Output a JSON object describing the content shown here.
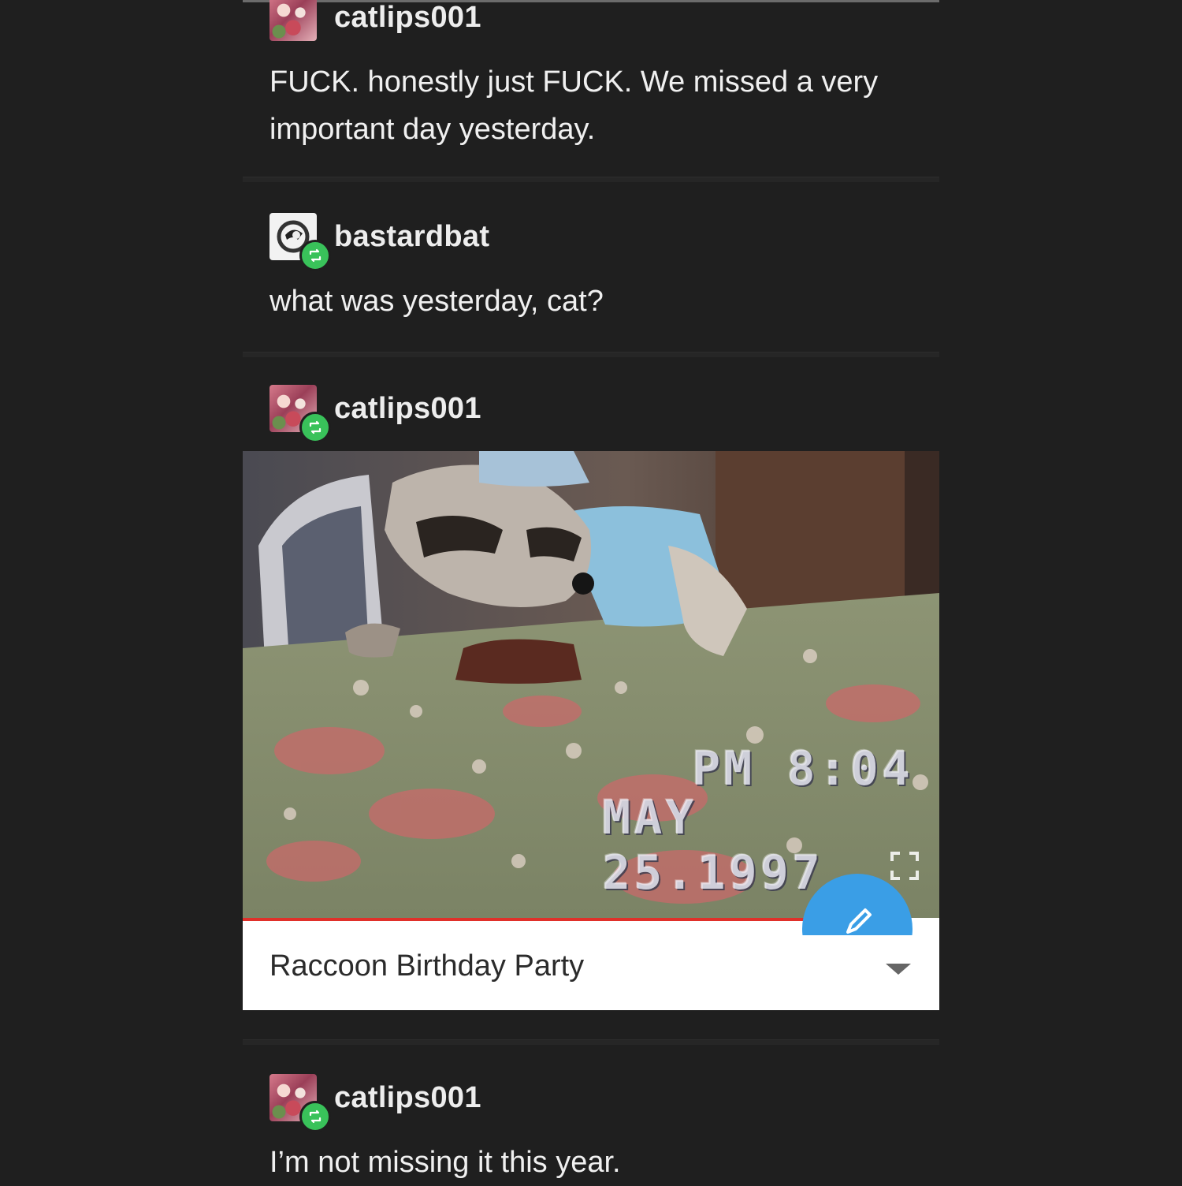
{
  "posts": [
    {
      "username": "catlips001",
      "text": "FUCK. honestly just FUCK. We missed a very important day yesterday.",
      "avatar": "cat-avatar"
    },
    {
      "username": "bastardbat",
      "text": "what was yesterday, cat?",
      "avatar": "bat-avatar",
      "reblog": true
    },
    {
      "username": "catlips001",
      "avatar": "cat-avatar",
      "reblog": true,
      "video": {
        "title": "Raccoon Birthday Party",
        "timestamp_time": "PM 8:04",
        "timestamp_date": "MAY 25.1997",
        "progress": 0.81
      }
    },
    {
      "username": "catlips001",
      "text": "I’m not missing it this year.",
      "avatar": "cat-avatar",
      "reblog": true
    }
  ],
  "colors": {
    "background": "#1f1f1f",
    "reblog_green": "#39c25a",
    "progress_red": "#e0302a",
    "fab_blue": "#3a9ee6"
  }
}
